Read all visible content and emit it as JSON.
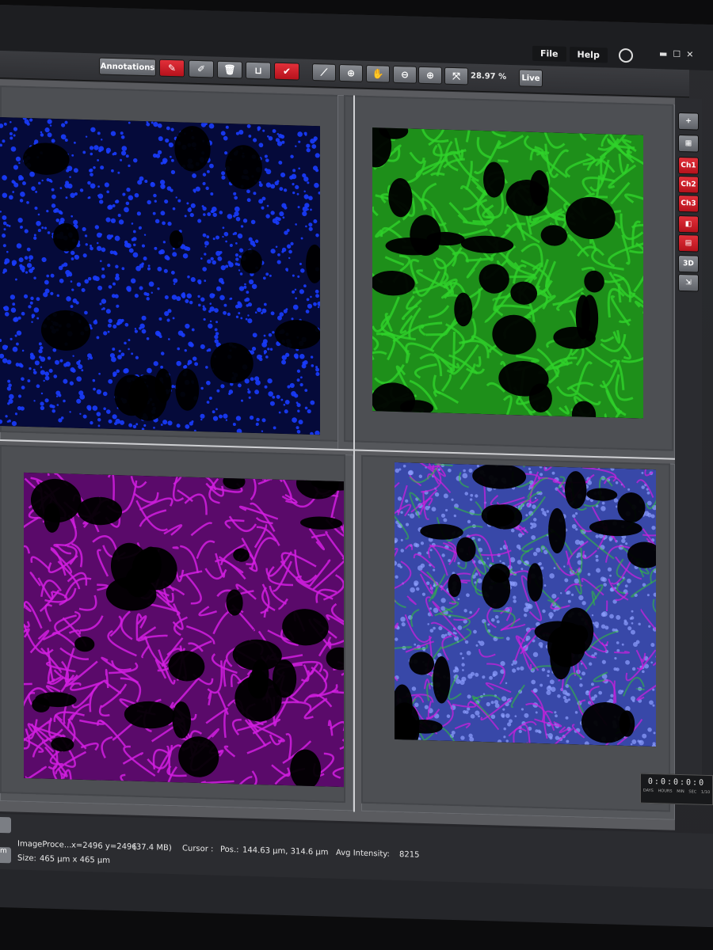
{
  "menu": {
    "file": "File",
    "help": "Help"
  },
  "window_controls": [
    "▬",
    "☐",
    "✕"
  ],
  "toolbar": {
    "annotations_label": "Annotations",
    "zoom": "28.97 %",
    "live_label": "Live",
    "icons": [
      "pen-icon",
      "erase-icon",
      "trash-icon",
      "measure-icon",
      "check-icon",
      "ruler-icon",
      "crosshair-icon",
      "hand-icon",
      "zoom-out-icon",
      "zoom-in-icon",
      "fit-icon"
    ]
  },
  "side_panel": {
    "ch1": "Ch1",
    "ch2": "Ch2",
    "ch3": "Ch3",
    "three_d": "3D"
  },
  "colors": {
    "channel1": "#1a3cff",
    "channel2": "#2fd22a",
    "channel3": "#d21ee0",
    "accent_red": "#d11c26"
  },
  "timer": {
    "value": "0:0:0:0:0",
    "units": [
      "DAYS",
      "HOURS",
      "MIN",
      "SEC",
      "1/10"
    ]
  },
  "status": {
    "name": "ImageProce...",
    "dims": "x=2496 y=2496",
    "filesize": "(37.4 MB)",
    "cursor_label": "Cursor :",
    "pos_label": "Pos.:",
    "pos_value": "144.63 µm, 314.6 µm",
    "avg_label": "Avg Intensity:",
    "avg_value": "8215",
    "size_label": "Size:",
    "size_value": "465 µm x 465 µm",
    "left_btn": "m"
  }
}
